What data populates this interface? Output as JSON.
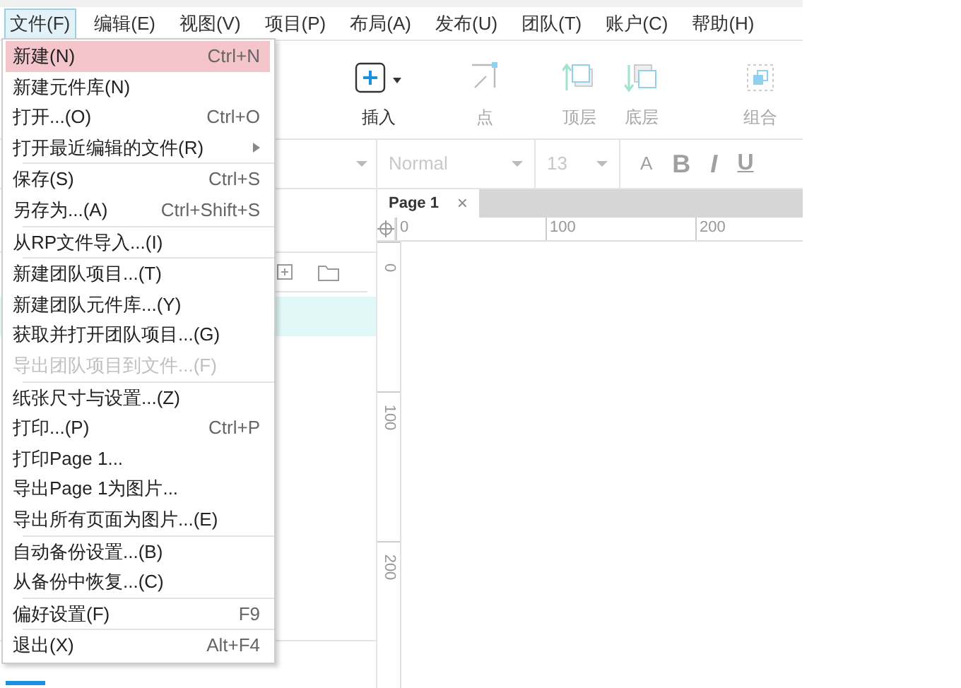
{
  "menubar": [
    {
      "label": "文件(F)",
      "selected": true
    },
    {
      "label": "编辑(E)",
      "selected": false
    },
    {
      "label": "视图(V)",
      "selected": false
    },
    {
      "label": "项目(P)",
      "selected": false
    },
    {
      "label": "布局(A)",
      "selected": false
    },
    {
      "label": "发布(U)",
      "selected": false
    },
    {
      "label": "团队(T)",
      "selected": false
    },
    {
      "label": "账户(C)",
      "selected": false
    },
    {
      "label": "帮助(H)",
      "selected": false
    }
  ],
  "file_menu": {
    "groups": [
      [
        {
          "label": "新建(N)",
          "shortcut": "Ctrl+N",
          "selected": true,
          "disabled": false,
          "submenu": false
        },
        {
          "label": "新建元件库(N)",
          "selected": false,
          "disabled": false,
          "submenu": false
        },
        {
          "label": "打开...(O)",
          "shortcut": "Ctrl+O",
          "selected": false,
          "disabled": false,
          "submenu": false
        },
        {
          "label": "打开最近编辑的文件(R)",
          "selected": false,
          "disabled": false,
          "submenu": true
        }
      ],
      [
        {
          "label": "保存(S)",
          "shortcut": "Ctrl+S",
          "selected": false,
          "disabled": false,
          "submenu": false
        },
        {
          "label": "另存为...(A)",
          "shortcut": "Ctrl+Shift+S",
          "selected": false,
          "disabled": false,
          "submenu": false
        }
      ],
      [
        {
          "label": "从RP文件导入...(I)",
          "selected": false,
          "disabled": false,
          "submenu": false
        }
      ],
      [
        {
          "label": "新建团队项目...(T)",
          "selected": false,
          "disabled": false,
          "submenu": false
        },
        {
          "label": "新建团队元件库...(Y)",
          "selected": false,
          "disabled": false,
          "submenu": false
        },
        {
          "label": "获取并打开团队项目...(G)",
          "selected": false,
          "disabled": false,
          "submenu": false
        },
        {
          "label": "导出团队项目到文件...(F)",
          "selected": false,
          "disabled": true,
          "submenu": false
        }
      ],
      [
        {
          "label": "纸张尺寸与设置...(Z)",
          "selected": false,
          "disabled": false,
          "submenu": false
        },
        {
          "label": "打印...(P)",
          "shortcut": "Ctrl+P",
          "selected": false,
          "disabled": false,
          "submenu": false
        },
        {
          "label": "打印Page 1...",
          "selected": false,
          "disabled": false,
          "submenu": false
        },
        {
          "label": "导出Page 1为图片...",
          "selected": false,
          "disabled": false,
          "submenu": false
        },
        {
          "label": "导出所有页面为图片...(E)",
          "selected": false,
          "disabled": false,
          "submenu": false
        }
      ],
      [
        {
          "label": "自动备份设置...(B)",
          "selected": false,
          "disabled": false,
          "submenu": false
        },
        {
          "label": "从备份中恢复...(C)",
          "selected": false,
          "disabled": false,
          "submenu": false
        }
      ],
      [
        {
          "label": "偏好设置(F)",
          "shortcut": "F9",
          "selected": false,
          "disabled": false,
          "submenu": false
        }
      ],
      [
        {
          "label": "退出(X)",
          "shortcut": "Alt+F4",
          "selected": false,
          "disabled": false,
          "submenu": false
        }
      ]
    ]
  },
  "toolbar": [
    {
      "kind": "insert",
      "label": "插入",
      "disabled": false
    },
    {
      "kind": "point",
      "label": "点",
      "disabled": true
    },
    {
      "kind": "front",
      "label": "顶层",
      "disabled": true
    },
    {
      "kind": "back",
      "label": "底层",
      "disabled": true
    },
    {
      "kind": "group",
      "label": "组合",
      "disabled": true
    }
  ],
  "format_bar": {
    "style": "Normal",
    "size": "13",
    "buttons": [
      {
        "kind": "font-color",
        "label": "A"
      },
      {
        "kind": "bold",
        "label": "B"
      },
      {
        "kind": "italic",
        "label": "I"
      },
      {
        "kind": "underline",
        "label": "U"
      }
    ]
  },
  "page_tabs": [
    {
      "label": "Page 1",
      "close": "×",
      "selected": true
    }
  ],
  "ruler": {
    "x_labels": [
      "0",
      "100",
      "200"
    ],
    "y_labels": [
      "0",
      "100",
      "200"
    ]
  }
}
